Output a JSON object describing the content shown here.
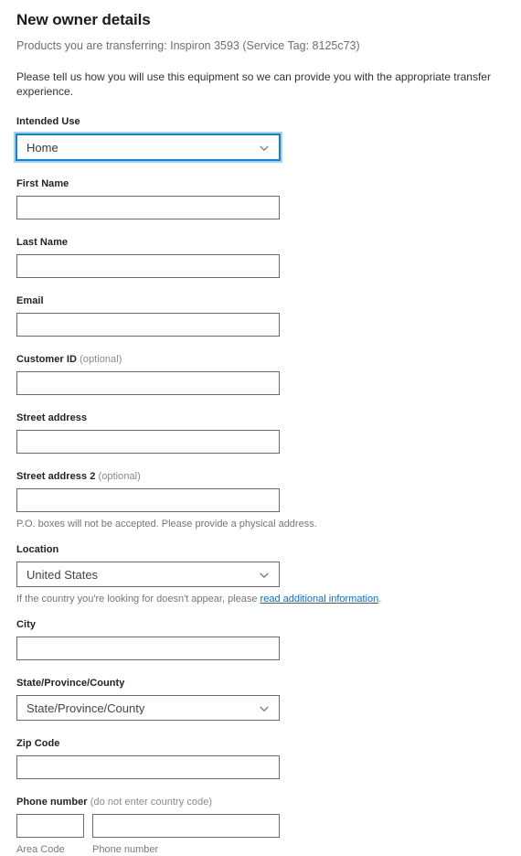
{
  "header": {
    "title": "New owner details",
    "subtitle": "Products you are transferring: Inspiron 3593 (Service Tag: 8125c73)",
    "intro": "Please tell us how you will use this equipment so we can provide you with the appropriate transfer experience."
  },
  "form": {
    "intended_use": {
      "label": "Intended Use",
      "value": "Home",
      "chevron_icon": "chevron-down-icon",
      "focused": true
    },
    "first_name": {
      "label": "First Name",
      "value": "",
      "placeholder": ""
    },
    "last_name": {
      "label": "Last Name",
      "value": "",
      "placeholder": ""
    },
    "email": {
      "label": "Email",
      "value": "",
      "placeholder": ""
    },
    "customer_id": {
      "label": "Customer ID",
      "optional": "(optional)",
      "value": "",
      "placeholder": ""
    },
    "street_address": {
      "label": "Street address",
      "value": "",
      "placeholder": ""
    },
    "street_address_2": {
      "label": "Street address 2",
      "optional": "(optional)",
      "value": "",
      "placeholder": "",
      "helper": "P.O. boxes will not be accepted. Please provide a physical address."
    },
    "location": {
      "label": "Location",
      "value": "United States",
      "chevron_icon": "chevron-down-icon",
      "helper_prefix": "If the country you're looking for doesn't appear, please ",
      "helper_link": "read additional information",
      "helper_suffix": "."
    },
    "city": {
      "label": "City",
      "value": "",
      "placeholder": ""
    },
    "state_province_county": {
      "label": "State/Province/County",
      "value": "State/Province/County",
      "chevron_icon": "chevron-down-icon"
    },
    "zip_code": {
      "label": "Zip Code",
      "value": "",
      "placeholder": ""
    },
    "phone": {
      "label": "Phone number",
      "optional": "(do not enter country code)",
      "area_code": {
        "value": "",
        "placeholder": "",
        "caption": "Area Code"
      },
      "number": {
        "value": "",
        "placeholder": "",
        "caption": "Phone number"
      }
    }
  },
  "colors": {
    "focus_border": "#1f7fc4",
    "focus_ring": "#a5d2f2",
    "input_border": "#6b6b6b",
    "link": "#0f6cbd",
    "text": "#2b2b2b",
    "muted": "#767676"
  }
}
